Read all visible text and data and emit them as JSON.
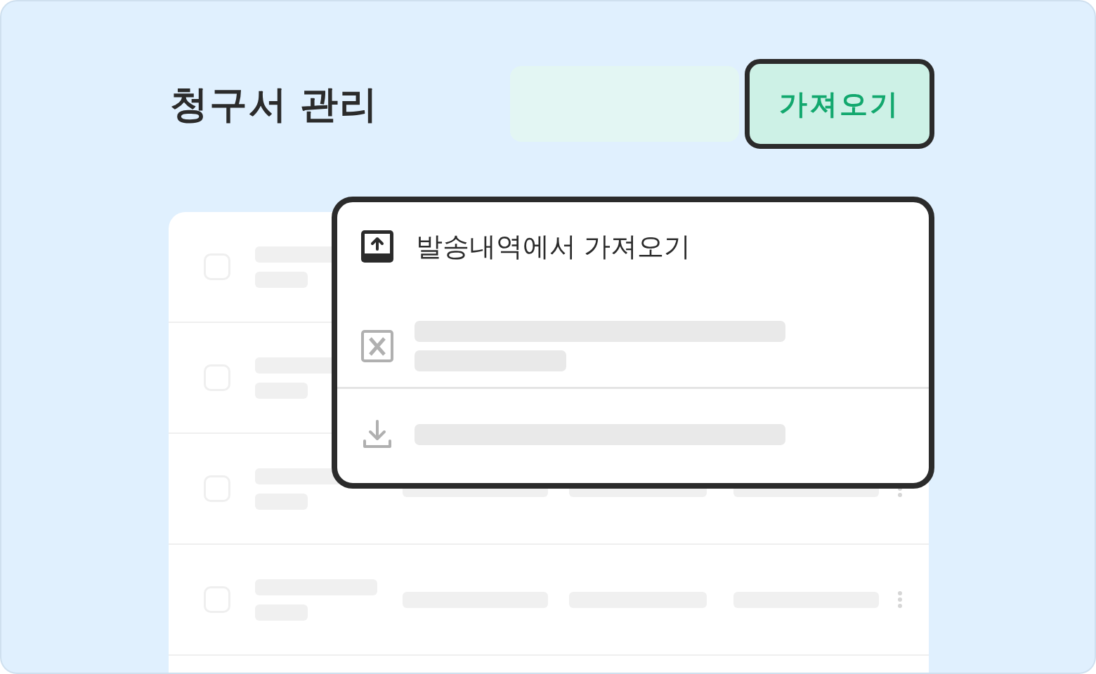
{
  "title": "청구서 관리",
  "import_button": {
    "label": "가져오기"
  },
  "import_menu": {
    "items": [
      {
        "kind": "text",
        "label": "발송내역에서 가져오기"
      },
      {
        "kind": "excel"
      },
      {
        "kind": "download"
      }
    ]
  },
  "invoice_rows": [
    {
      "checked": false
    },
    {
      "checked": false
    },
    {
      "checked": false
    },
    {
      "checked": false
    }
  ]
}
